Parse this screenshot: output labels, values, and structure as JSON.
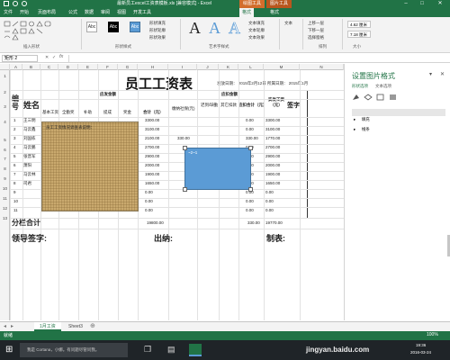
{
  "app": {
    "window_title": "最新员工excel工资表模板.xls [兼容模式] - Excel",
    "context_tab_group": "绘图工具",
    "context_tab_group2": "图片工具"
  },
  "tabs": [
    "文件",
    "开始",
    "页面布局",
    "公式",
    "数据",
    "审阅",
    "视图",
    "开发工具",
    "格式",
    "格式"
  ],
  "ribbon": {
    "groups": [
      "插入形状",
      "形状样式",
      "艺术字样式",
      "文本",
      "排列",
      "大小"
    ],
    "style_labels": [
      "Abc",
      "Abc",
      "Abc"
    ],
    "fill_label": "形状填充",
    "outline_label": "形状轮廓",
    "effect_label": "形状效果",
    "text_fill": "文本填充",
    "text_outline": "文本轮廓",
    "text_effect": "文本效果",
    "arrange_items": [
      "上移一层",
      "下移一层",
      "选择窗格"
    ],
    "size_h": "4.62 厘米",
    "size_w": "7.18 厘米"
  },
  "formula_bar": {
    "name_box": "矩形 2",
    "formula": ""
  },
  "columns": [
    "A",
    "B",
    "C",
    "D",
    "E",
    "F",
    "G",
    "H",
    "I",
    "J",
    "K",
    "L",
    "M",
    "N"
  ],
  "rows": [
    "1",
    "2",
    "3",
    "4",
    "5",
    "6",
    "7",
    "8",
    "9",
    "10",
    "11",
    "12",
    "13"
  ],
  "sheet": {
    "title": "员工工资表",
    "issue_date": "发放日期： 2015年2月12日 所属日期： 2015年1月",
    "h_no": "编号",
    "h_name": "姓名",
    "h_payable": "应发金额",
    "h_deduct": "应扣金额",
    "h_actual": "实发工资（元）",
    "h_sign": "签字",
    "sub_basic": "基本工资",
    "sub_allow": "全勤奖",
    "sub_subsidy": "补助",
    "sub_commission": "提成",
    "sub_bonus": "奖金",
    "sub_total": "合计（元）",
    "sub_ins": "缴纳社保(元)",
    "sub_other1": "迟到/缺勤",
    "sub_other2": "其它扣款",
    "sub_dtotal": "应扣合计（元）",
    "names": [
      "王三明",
      "马云鑫",
      "刘国栋",
      "马云鹏",
      "张晋军",
      "萧阳",
      "马云林",
      "司君",
      "",
      "",
      ""
    ],
    "row_nums": [
      "1",
      "2",
      "3",
      "4",
      "5",
      "6",
      "7",
      "8",
      "9",
      "10",
      "11"
    ],
    "totals": [
      "3300.00",
      "3100.00",
      "2100.00",
      "2700.00",
      "2900.00",
      "2000.00",
      "1900.00",
      "1650.00",
      "0.00",
      "0.00",
      "0.00"
    ],
    "insurance": [
      "",
      "",
      "330.00",
      "",
      "",
      "",
      "",
      "",
      "",
      "",
      ""
    ],
    "dtotals": [
      "0.00",
      "0.00",
      "330.00",
      "0.00",
      "0.00",
      "0.00",
      "0.00",
      "0.00",
      "0.00",
      "0.00",
      "0.00"
    ],
    "actuals": [
      "3300.00",
      "3100.00",
      "1770.00",
      "2700.00",
      "2900.00",
      "2000.00",
      "1900.00",
      "1650.00",
      "0.00",
      "0.00",
      "0.00"
    ],
    "subtotal_label": "分栏合计",
    "subtotal_value": "19800.00",
    "subtotal_dvalue": "330.00",
    "subtotal_actual": "19770.00",
    "sig_leader": "领导签字:",
    "sig_cashier": "出纳:",
    "sig_maker": "制表:",
    "overlay_text": "员工工资情况调查表说明：",
    "blue_text": "~2~1"
  },
  "pane": {
    "title": "设置图片格式",
    "tab1": "形状选项",
    "tab2": "文本选项",
    "section1": "填充",
    "section2": "线条"
  },
  "sheet_tabs": [
    "1月工资",
    "Sheet3"
  ],
  "status": {
    "ready": "就绪",
    "zoom": "100%"
  },
  "taskbar": {
    "search": "我是 Cortana，小娜。有问题尽管问我。",
    "time": "19:36",
    "date": "2016-03-24",
    "watermark": "jingyan.baidu.com"
  },
  "colors": {
    "excel_green": "#217346",
    "context_orange": "#d36d2c",
    "shape_blue": "#5b9bd5",
    "burlap": "#c9a96e"
  }
}
